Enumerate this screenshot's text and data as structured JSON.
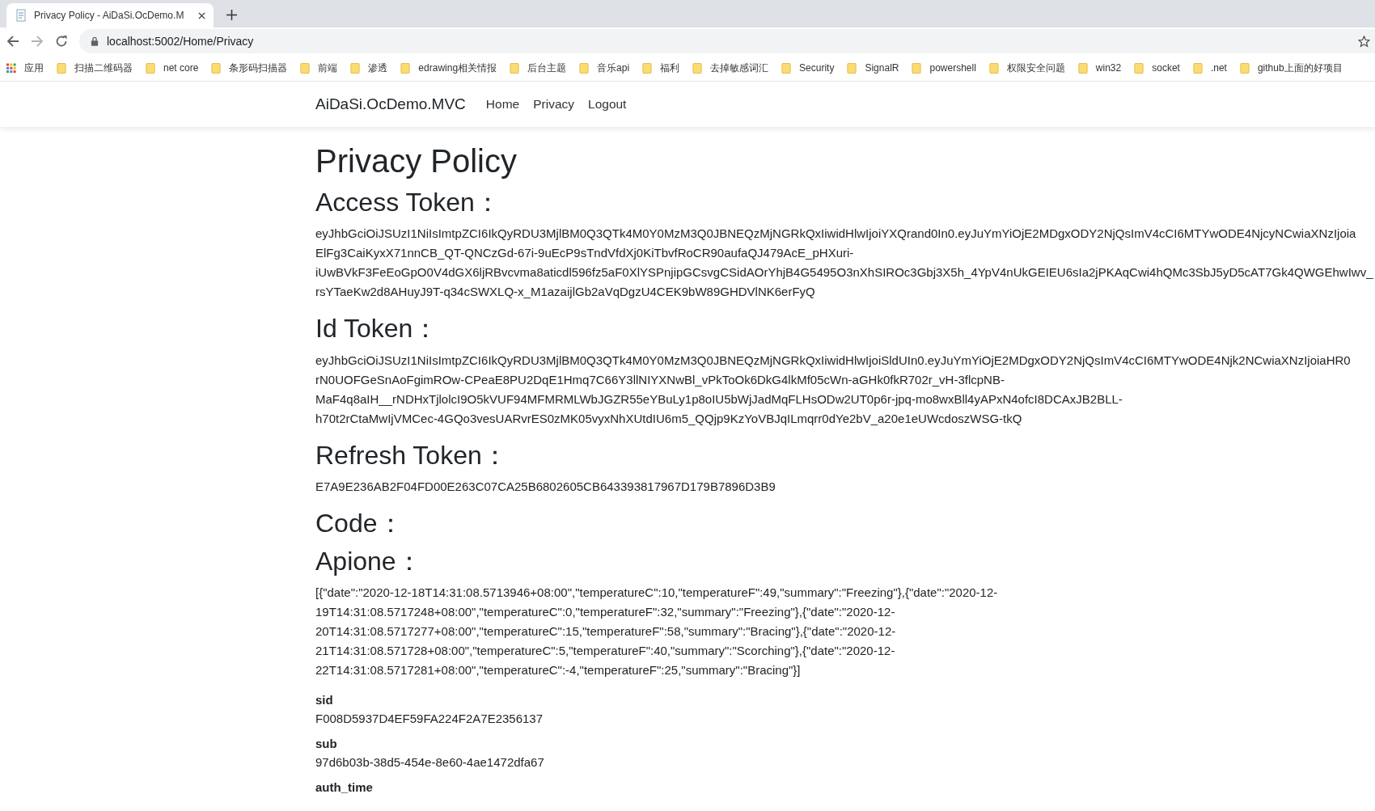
{
  "browser": {
    "tab": {
      "title": "Privacy Policy - AiDaSi.OcDemo.M",
      "selected": true
    },
    "address": "localhost:5002/Home/Privacy",
    "bookmarks": [
      {
        "kind": "apps",
        "label": "应用"
      },
      {
        "kind": "folder",
        "label": "扫描二维码器"
      },
      {
        "kind": "folder",
        "label": "net core"
      },
      {
        "kind": "folder",
        "label": "条形码扫描器"
      },
      {
        "kind": "folder",
        "label": "前端"
      },
      {
        "kind": "folder",
        "label": "渗透"
      },
      {
        "kind": "folder",
        "label": "edrawing相关情报"
      },
      {
        "kind": "folder",
        "label": "后台主题"
      },
      {
        "kind": "folder",
        "label": "音乐api"
      },
      {
        "kind": "folder",
        "label": "福利"
      },
      {
        "kind": "folder",
        "label": "去掉敏感词汇"
      },
      {
        "kind": "folder",
        "label": "Security"
      },
      {
        "kind": "folder",
        "label": "SignalR"
      },
      {
        "kind": "folder",
        "label": "powershell"
      },
      {
        "kind": "folder",
        "label": "权限安全问题"
      },
      {
        "kind": "folder",
        "label": "win32"
      },
      {
        "kind": "folder",
        "label": "socket"
      },
      {
        "kind": "folder",
        "label": ".net"
      },
      {
        "kind": "folder",
        "label": "github上面的好项目"
      }
    ]
  },
  "navbar": {
    "brand": "AiDaSi.OcDemo.MVC",
    "links": [
      "Home",
      "Privacy",
      "Logout"
    ]
  },
  "page": {
    "title": "Privacy Policy",
    "sections": [
      {
        "title": "Access Token：",
        "lines": [
          "eyJhbGciOiJSUzI1NiIsImtpZCI6IkQyRDU3MjlBM0Q3QTk4M0Y0MzM3Q0JBNEQzMjNGRkQxIiwidHlwIjoiYXQrand0In0.eyJuYmYiOjE2MDgxODY2NjQsImV4cCI6MTYwODE4NjcyNCwiaXNzIjoia",
          "ElFg3CaiKyxX71nnCB_QT-QNCzGd-67i-9uEcP9sTndVfdXj0KiTbvfRoCR90aufaQJ479AcE_pHXuri-",
          "iUwBVkF3FeEoGpO0V4dGX6ljRBvcvma8aticdl596fz5aF0XlYSPnjipGCsvgCSidAOrYhjB4G5495O3nXhSIROc3Gbj3X5h_4YpV4nUkGEIEU6sIa2jPKAqCwi4hQMc3SbJ5yD5cAT7Gk4QWGEhwIwv_",
          "rsYTaeKw2d8AHuyJ9T-q34cSWXLQ-x_M1azaijlGb2aVqDgzU4CEK9bW89GHDVlNK6erFyQ"
        ]
      },
      {
        "title": "Id Token：",
        "lines": [
          "eyJhbGciOiJSUzI1NiIsImtpZCI6IkQyRDU3MjlBM0Q3QTk4M0Y0MzM3Q0JBNEQzMjNGRkQxIiwidHlwIjoiSldUIn0.eyJuYmYiOjE2MDgxODY2NjQsImV4cCI6MTYwODE4Njk2NCwiaXNzIjoiaHR0",
          "rN0UOFGeSnAoFgimROw-CPeaE8PU2DqE1Hmq7C66Y3llNIYXNwBl_vPkToOk6DkG4lkMf05cWn-aGHk0fkR702r_vH-3flcpNB-",
          "MaF4q8aIH__rNDHxTjlolcI9O5kVUF94MFMRMLWbJGZR55eYBuLy1p8oIU5bWjJadMqFLHsODw2UT0p6r-jpq-mo8wxBll4yAPxN4ofcI8DCAxJB2BLL-",
          "h70t2rCtaMwIjVMCec-4GQo3vesUARvrES0zMK05vyxNhXUtdIU6m5_QQjp9KzYoVBJqILmqrr0dYe2bV_a20e1eUWcdoszWSG-tkQ"
        ]
      },
      {
        "title": "Refresh Token：",
        "lines": [
          "E7A9E236AB2F04FD00E263C07CA25B6802605CB643393817967D179B7896D3B9"
        ]
      },
      {
        "title": "Code："
      },
      {
        "title": "Apione：",
        "lines": [
          "[{\"date\":\"2020-12-18T14:31:08.5713946+08:00\",\"temperatureC\":10,\"temperatureF\":49,\"summary\":\"Freezing\"},{\"date\":\"2020-12-",
          "19T14:31:08.5717248+08:00\",\"temperatureC\":0,\"temperatureF\":32,\"summary\":\"Freezing\"},{\"date\":\"2020-12-",
          "20T14:31:08.5717277+08:00\",\"temperatureC\":15,\"temperatureF\":58,\"summary\":\"Bracing\"},{\"date\":\"2020-12-",
          "21T14:31:08.571728+08:00\",\"temperatureC\":5,\"temperatureF\":40,\"summary\":\"Scorching\"},{\"date\":\"2020-12-",
          "22T14:31:08.5717281+08:00\",\"temperatureC\":-4,\"temperatureF\":25,\"summary\":\"Bracing\"}]"
        ]
      }
    ],
    "claims": [
      {
        "name": "sid",
        "value": "F008D5937D4EF59FA224F2A7E2356137"
      },
      {
        "name": "sub",
        "value": "97d6b03b-38d5-454e-8e60-4ae1472dfa67"
      },
      {
        "name": "auth_time"
      }
    ]
  }
}
